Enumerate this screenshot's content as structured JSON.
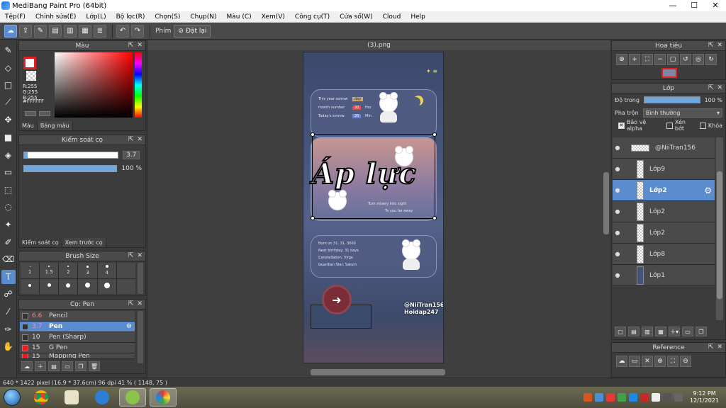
{
  "window": {
    "title": "MediBang Paint Pro (64bit)",
    "controls": [
      "—",
      "☐",
      "✕"
    ]
  },
  "menu": [
    "Tệp(F)",
    "Chỉnh sửa(E)",
    "Lớp(L)",
    "Bộ lọc(R)",
    "Chọn(S)",
    "Chụp(N)",
    "Màu (C)",
    "Xem(V)",
    "Công cụ(T)",
    "Cửa sổ(W)",
    "Cloud",
    "Help"
  ],
  "toolbar": {
    "phim_label": "Phím",
    "reset_label": "Đặt lại"
  },
  "color_panel": {
    "title": "Màu",
    "r": "R:255",
    "g": "G:255",
    "b": "B:255",
    "hex": "#FFFFFF",
    "tabs": [
      "Màu",
      "Bảng màu"
    ],
    "fg_color": "#FFFFFF",
    "accent": "#E02020"
  },
  "brush_control": {
    "title": "Kiểm soát cọ",
    "size_value": "3.7",
    "opacity_value": "100 %",
    "opacity_fraction": 1.0,
    "tabs": [
      "Kiểm soát cọ",
      "Xem trước cọ"
    ]
  },
  "brush_size": {
    "title": "Brush Size",
    "sizes": [
      "1",
      "1.5",
      "2",
      "3",
      "4",
      "",
      "",
      "",
      "",
      "",
      "",
      ""
    ]
  },
  "brush_list": {
    "title": "Cọ: Pen",
    "items": [
      {
        "size": "6.6",
        "name": "Pencil",
        "color": "#333333"
      },
      {
        "size": "3.7",
        "name": "Pen",
        "color": "#333333"
      },
      {
        "size": "10",
        "name": "Pen (Sharp)",
        "color": "#333333"
      },
      {
        "size": "15",
        "name": "G Pen",
        "color": "#E02020"
      },
      {
        "size": "15",
        "name": "Mapping Pen",
        "color": "#E02020"
      }
    ]
  },
  "canvas": {
    "doc_title": "(3).png",
    "artwork": {
      "card1_lines": [
        "This year sorrow",
        "month number",
        "Today's sorrow"
      ],
      "card1_boxes": [
        "day",
        "20",
        "20"
      ],
      "card1_units": [
        "Hrs",
        "Min"
      ],
      "big_title": "Áp lực",
      "card2_line1": "Turn misery into sight",
      "card2_line2": "To you far away",
      "card3_lines": [
        "Born on 31. 31. 3000",
        "Next birthday: 31 days",
        "Constellation: Virgo",
        "Guardian Star: Saturn"
      ],
      "credit_line1": "@NiiTran156",
      "credit_line2": "Hoidap247"
    }
  },
  "navigator": {
    "title": "Hoa tiêu"
  },
  "layer_panel": {
    "title": "Lớp",
    "opacity_label": "Độ trong",
    "opacity_value": "100 %",
    "blend_label": "Pha trộn",
    "blend_value": "Bình thường",
    "checks": [
      "Bảo vệ alpha",
      "Xén bớt",
      "Khóa"
    ],
    "layers": [
      "@NiiTran156",
      "Lớp9",
      "Lớp2",
      "Lớp2",
      "Lớp2",
      "Lớp8",
      "Lớp1"
    ]
  },
  "reference": {
    "title": "Reference"
  },
  "status": {
    "text": "640 * 1422 pixel  (16.9 * 37.6cm)  96 dpi  41 %  ( 1148, 75 )"
  },
  "taskbar": {
    "time": "9:12 PM",
    "date": "12/1/2021"
  }
}
